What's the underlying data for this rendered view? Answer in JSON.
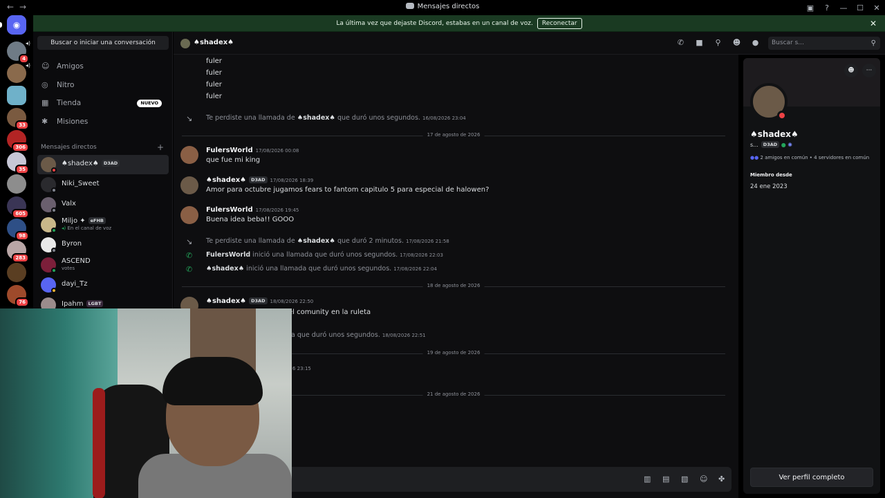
{
  "window": {
    "title": "Mensajes directos"
  },
  "banner": {
    "text": "La última vez que dejaste Discord, estabas en un canal de voz.",
    "button": "Reconectar"
  },
  "servers": {
    "badges": [
      "4",
      "33",
      "306",
      "35",
      "605",
      "98",
      "283",
      "76"
    ]
  },
  "dm_sidebar": {
    "search": "Buscar o iniciar una conversación",
    "nav": [
      {
        "label": "Amigos",
        "icon": "friends-icon"
      },
      {
        "label": "Nitro",
        "icon": "nitro-icon"
      },
      {
        "label": "Tienda",
        "icon": "shop-icon",
        "badge": "NUEVO"
      },
      {
        "label": "Misiones",
        "icon": "quests-icon"
      }
    ],
    "section_title": "Mensajes directos",
    "dms": [
      {
        "name": "♠shadex♠",
        "tag": "D3AD",
        "status": "dnd",
        "selected": true
      },
      {
        "name": "Niki_Sweet",
        "status": "offline"
      },
      {
        "name": "Valx",
        "status": "offline"
      },
      {
        "name": "Miljo ✦",
        "tag": "eFHB",
        "sub": "En el canal de voz",
        "status": "online"
      },
      {
        "name": "Byron",
        "status": "offline"
      },
      {
        "name": "ASCEND",
        "sub": "votes",
        "status": "online"
      },
      {
        "name": "dayi_Tz",
        "status": "idle"
      },
      {
        "name": "Ipahm",
        "tag": "LGBT",
        "status": "offline"
      }
    ]
  },
  "chat": {
    "header_name": "♠shadex♠",
    "search_placeholder": "Buscar s...",
    "lines": [
      "fuler",
      "fuler",
      "fuler",
      "fuler"
    ],
    "missed1": {
      "prefix": "Te perdiste una llamada de ",
      "name": "♠shadex♠",
      "suffix": " que duró unos segundos.",
      "ts": "16/08/2026 23:04"
    },
    "div1": "17 de agosto de 2026",
    "m1": {
      "author": "FulersWorld",
      "ts": "17/08/2026 00:08",
      "text": "que fue mi king"
    },
    "m2": {
      "author": "♠shadex♠",
      "tag": "D3AD",
      "ts": "17/08/2026 18:39",
      "text": "Amor para octubre jugamos fears to fantom capitulo 5 para especial de halowen?"
    },
    "m3": {
      "author": "FulersWorld",
      "ts": "17/08/2026 19:45",
      "text": "Buena idea beba!! GOOO"
    },
    "missed2": {
      "prefix": "Te perdiste una llamada de ",
      "name": "♠shadex♠",
      "suffix": " que duró 2 minutos.",
      "ts": "17/08/2026 21:58"
    },
    "call1": {
      "name": "FulersWorld",
      "suffix": " inició una llamada que duró unos segundos.",
      "ts": "17/08/2026 22:03"
    },
    "call2": {
      "name": "♠shadex♠",
      "suffix": " inició una llamada que duró unos segundos.",
      "ts": "17/08/2026 22:04"
    },
    "div2": "18 de agosto de 2026",
    "m4": {
      "author": "♠shadex♠",
      "tag": "D3AD",
      "ts": "18/08/2026 22:50",
      "text": "el  comunity en la ruleta"
    },
    "call3": {
      "suffix": "a que duró unos segundos.",
      "ts": "18/08/2026 22:51"
    },
    "div3": "19 de agosto de 2026",
    "call4_ts": "6 23:15",
    "div4": "21 de agosto de 2026"
  },
  "profile": {
    "name": "♠shadex♠",
    "short": "s...",
    "tag": "D3AD",
    "mutual_friends": "2 amigos en común",
    "mutual_servers": "4 servidores en común",
    "member_since_label": "Miembro desde",
    "member_since": "24 ene 2023",
    "button": "Ver perfil completo"
  },
  "colors": {
    "accent": "#5865f2",
    "banner": "#1a3a22",
    "online": "#23a55a",
    "dnd": "#ed4245",
    "idle": "#f0b232"
  }
}
